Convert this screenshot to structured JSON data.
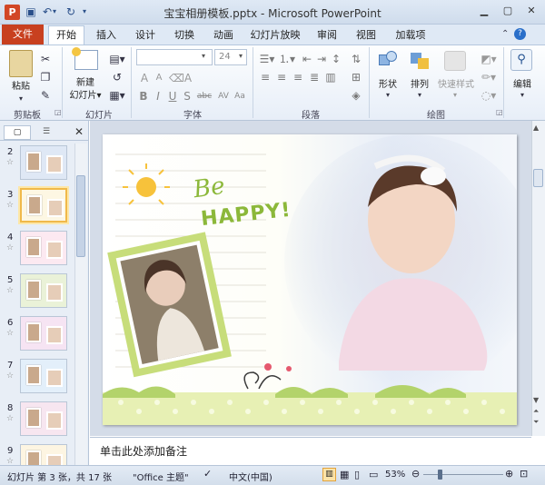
{
  "window": {
    "title": "宝宝相册模板.pptx - Microsoft PowerPoint",
    "app_icon": "P"
  },
  "tabs": [
    "文件",
    "开始",
    "插入",
    "设计",
    "切换",
    "动画",
    "幻灯片放映",
    "审阅",
    "视图",
    "加载项"
  ],
  "ribbon": {
    "clipboard": {
      "paste": "粘贴",
      "group": "剪贴板"
    },
    "slides": {
      "new_slide_1": "新建",
      "new_slide_2": "幻灯片▾",
      "group": "幻灯片"
    },
    "font": {
      "size": "24",
      "group": "字体"
    },
    "paragraph": {
      "group": "段落"
    },
    "drawing": {
      "shape": "形状",
      "arrange": "排列",
      "quick_styles": "快速样式",
      "group": "绘图"
    },
    "editing": {
      "edit": "编辑"
    }
  },
  "slide_panel": {
    "slides": [
      {
        "num": "2"
      },
      {
        "num": "3"
      },
      {
        "num": "4"
      },
      {
        "num": "5"
      },
      {
        "num": "6"
      },
      {
        "num": "7"
      },
      {
        "num": "8"
      },
      {
        "num": "9"
      }
    ]
  },
  "slide": {
    "be_text": "Be",
    "happy_text": "HAPPY!"
  },
  "notes": {
    "placeholder": "单击此处添加备注"
  },
  "status": {
    "slide_info": "幻灯片 第 3 张，共 17 张",
    "theme": "\"Office 主题\"",
    "language": "中文(中国)",
    "zoom": "53%"
  },
  "colors": {
    "file_tab": "#c8401f",
    "accent": "#2a4f8a"
  }
}
